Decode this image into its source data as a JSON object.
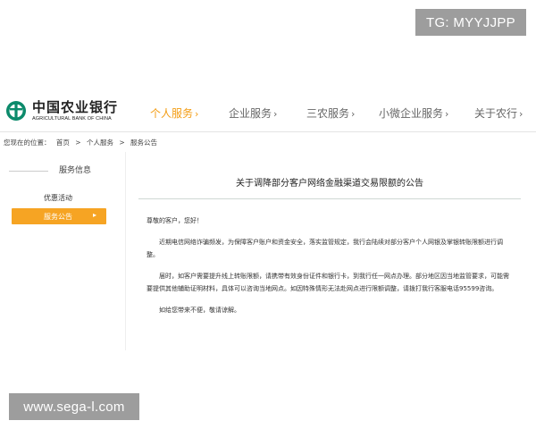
{
  "watermarks": {
    "top": "TG: MYYJJPP",
    "bottom": "www.sega-l.com"
  },
  "header": {
    "logo_cn": "中国农业银行",
    "logo_en": "AGRICULTURAL BANK OF CHINA",
    "nav": [
      {
        "label": "个人服务",
        "active": true
      },
      {
        "label": "企业服务",
        "active": false
      },
      {
        "label": "三农服务",
        "active": false
      },
      {
        "label": "小微企业服务",
        "active": false
      },
      {
        "label": "关于农行",
        "active": false
      }
    ],
    "chevron": "›"
  },
  "breadcrumb": {
    "prefix": "您现在的位置：",
    "items": [
      "首页",
      "个人服务",
      "服务公告"
    ],
    "separator": ">"
  },
  "sidebar": {
    "title": "服务信息",
    "items": [
      {
        "label": "优惠活动",
        "active": false
      },
      {
        "label": "服务公告",
        "active": true
      }
    ],
    "active_arrow": "▸"
  },
  "article": {
    "title": "关于调降部分客户网络金融渠道交易限额的公告",
    "greeting": "尊敬的客户，您好！",
    "paragraphs": [
      "近期电信网络诈骗频发，为保障客户账户和资金安全，落实监管规定，我行会陆续对部分客户个人网银及掌银转账限额进行调整。",
      "届时，如客户需要提升线上转账限额，请携带有效身份证件和银行卡，到我行任一网点办理。部分地区因当地监管要求，可能需要提供其他辅助证明材料，具体可以咨询当地网点。如因特殊情形无法赴网点进行限额调整，请拨打我行客服电话95599咨询。",
      "如给您带来不便，敬请谅解。"
    ]
  },
  "colors": {
    "accent": "#f39c12",
    "sidebar_active": "#f6a423",
    "logo_green": "#0c8a6b"
  }
}
